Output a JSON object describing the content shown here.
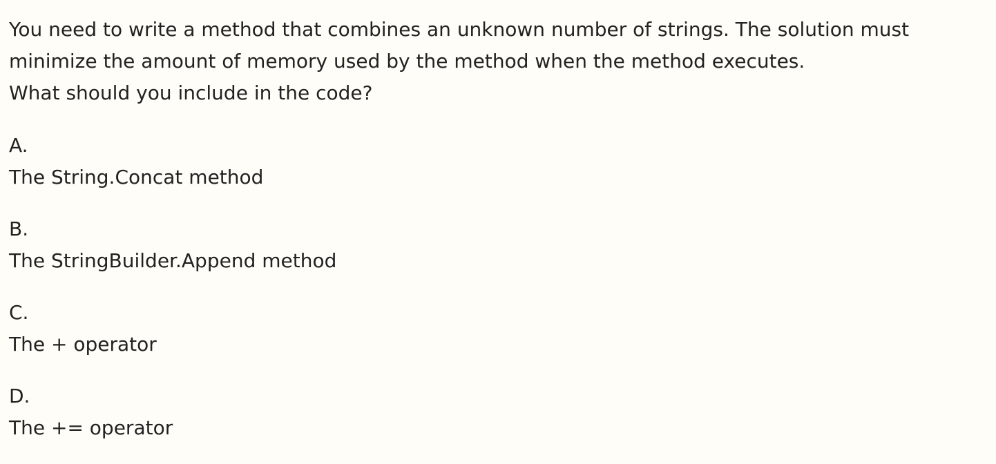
{
  "question": {
    "lines": [
      "You need to write a method that combines an unknown number of strings. The solution must",
      "minimize the amount of memory used by the method when the method executes.",
      "What should you include in the code?"
    ]
  },
  "options": [
    {
      "letter": "A.",
      "text": "The String.Concat method"
    },
    {
      "letter": "B.",
      "text": "The StringBuilder.Append method"
    },
    {
      "letter": "C.",
      "text": "The + operator"
    },
    {
      "letter": "D.",
      "text": "The += operator"
    }
  ]
}
